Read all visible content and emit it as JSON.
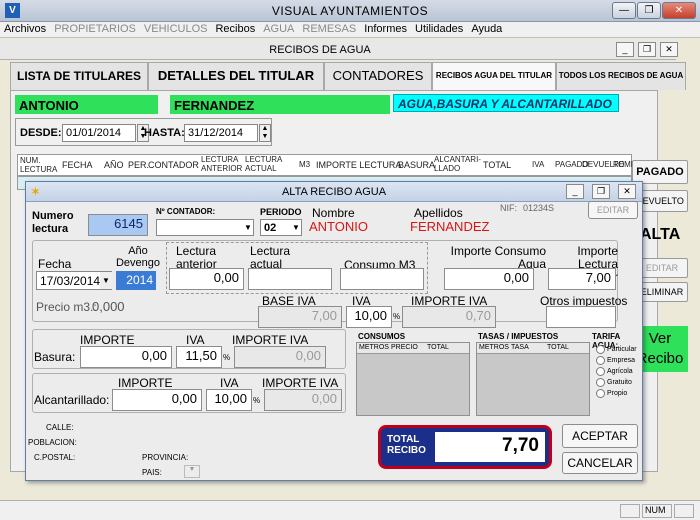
{
  "app": {
    "title": "VISUAL AYUNTAMIENTOS",
    "logo": "V"
  },
  "menu": [
    "Archivos",
    "PROPIETARIOS",
    "VEHICULOS",
    "Recibos",
    "AGUA",
    "REMESAS",
    "Informes",
    "Utilidades",
    "Ayuda"
  ],
  "child": {
    "title": "RECIBOS DE AGUA"
  },
  "tabs": [
    "LISTA DE TITULARES",
    "DETALLES DEL TITULAR",
    "CONTADORES",
    "RECIBOS AGUA DEL TITULAR",
    "TODOS LOS RECIBOS DE AGUA"
  ],
  "titular": {
    "nombre": "ANTONIO",
    "apellidos": "FERNANDEZ",
    "tipo": "AGUA,BASURA Y ALCANTARILLADO"
  },
  "rango": {
    "desde_label": "DESDE:",
    "desde": "01/01/2014",
    "hasta_label": "HASTA:",
    "hasta": "31/12/2014"
  },
  "grid_headers": [
    "NUM. LECTURA",
    "FECHA",
    "AÑO",
    "PER.",
    "CONTADOR",
    "LECTURA ANTERIOR",
    "LECTURA ACTUAL",
    "M3",
    "IMPORTE LECTURA",
    "BASURA",
    "ALCANTARI- LLADO",
    "TOTAL",
    "IVA",
    "PAGADO",
    "DEVUELTO",
    "REME"
  ],
  "right_buttons": {
    "pagado": "PAGADO",
    "devuelto": "DEVUELTO",
    "alta": "ALTA",
    "editar": "EDITAR",
    "eliminar": "ELIMINAR",
    "ver_recibo_1": "Ver",
    "ver_recibo_2": "Recibo"
  },
  "dialog": {
    "title": "ALTA RECIBO AGUA",
    "numero_lectura_label": "Numero lectura",
    "numero_lectura": "6145",
    "contador_label": "Nº CONTADOR:",
    "contador": "",
    "periodo_label": "PERIODO",
    "periodo": "02",
    "nombre_label": "Nombre",
    "nombre": "ANTONIO",
    "apellidos_label": "Apellidos",
    "apellidos": "FERNANDEZ",
    "nif_label": "NIF:",
    "nif": "01234S",
    "editar": "EDITAR",
    "fecha_label": "Fecha",
    "fecha": "17/03/2014",
    "anio_label": "Año Devengo",
    "anio": "2014",
    "lectura_anterior_label": "Lectura anterior",
    "lectura_anterior": "0,00",
    "lectura_actual_label": "Lectura actual",
    "lectura_actual": "",
    "consumo_label": "Consumo M3",
    "consumo": "",
    "importe_consumo_label": "Importe Consumo Agua",
    "importe_consumo": "0,00",
    "importe_lectura_label": "Importe Lectura Contador",
    "importe_lectura": "7,00",
    "precio_m3_label": "Precio m3.:",
    "precio_m3": "0,000",
    "base_iva_label": "BASE IVA",
    "base_iva": "7,00",
    "iva_label": "IVA",
    "iva": "10,00",
    "pct": "%",
    "importe_iva_label": "IMPORTE IVA",
    "importe_iva": "0,70",
    "otros_label": "Otros impuestos",
    "otros": "",
    "importe_label": "IMPORTE",
    "basura_label": "Basura:",
    "basura_importe": "0,00",
    "basura_iva": "11,50",
    "basura_importe_iva": "0,00",
    "alc_label": "Alcantarillado:",
    "alc_importe": "0,00",
    "alc_iva": "10,00",
    "alc_importe_iva": "0,00",
    "consumos_label": "CONSUMOS",
    "consumos_cols": [
      "METROS",
      "PRECIO",
      "TOTAL"
    ],
    "tasas_label": "TASAS / IMPUESTOS",
    "tasas_cols": [
      "METROS",
      "TASA",
      "TOTAL"
    ],
    "tarifa_label": "TARIFA AGUA:",
    "tarifas": [
      "Particular",
      "Empresa",
      "Agrícola",
      "Gratuito",
      "Propio"
    ],
    "calle_label": "CALLE:",
    "poblacion_label": "POBLACION:",
    "cpostal_label": "C.POSTAL:",
    "provincia_label": "PROVINCIA:",
    "pais_label": "PAIS:",
    "total_label_1": "TOTAL",
    "total_label_2": "RECIBO",
    "total": "7,70",
    "aceptar": "ACEPTAR",
    "cancelar": "CANCELAR"
  },
  "status": {
    "num": "NUM"
  },
  "colors": {
    "green": "#2ee05a",
    "cyan": "#00ffff",
    "red_value": "#d81414",
    "total_border": "#c0001a",
    "selected_year": "#3a7bd5"
  }
}
